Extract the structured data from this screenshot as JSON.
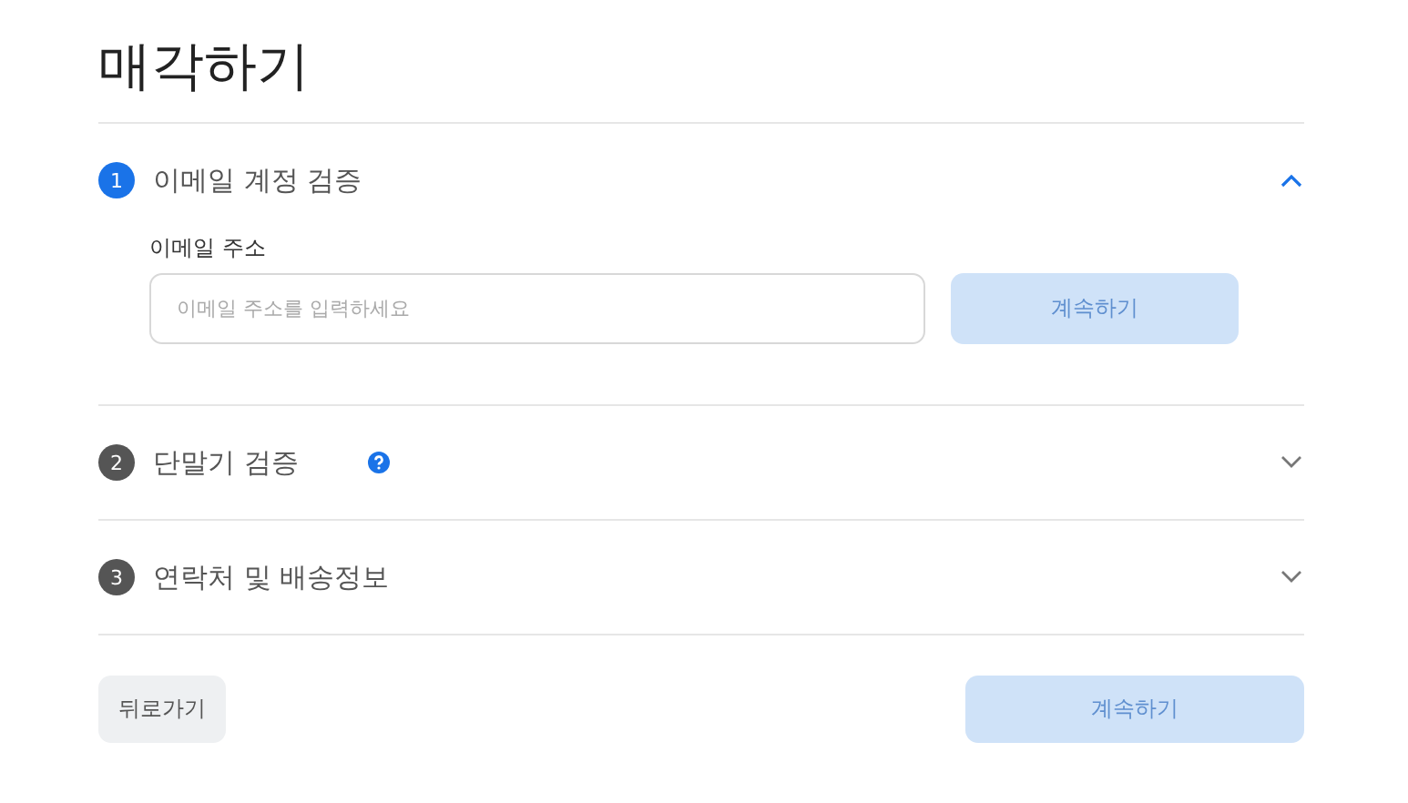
{
  "title": "매각하기",
  "steps": [
    {
      "number": "1",
      "title": "이메일 계정 검증",
      "expanded": true,
      "help": false,
      "form": {
        "label": "이메일 주소",
        "placeholder": "이메일 주소를 입력하세요",
        "button": {
          "label": "계속하기",
          "disabled": true
        }
      }
    },
    {
      "number": "2",
      "title": "단말기 검증",
      "expanded": false,
      "help": true
    },
    {
      "number": "3",
      "title": "연락처 및 배송정보",
      "expanded": false,
      "help": false
    }
  ],
  "footer": {
    "back": {
      "label": "뒤로가기"
    },
    "continue": {
      "label": "계속하기",
      "disabled": true
    }
  }
}
